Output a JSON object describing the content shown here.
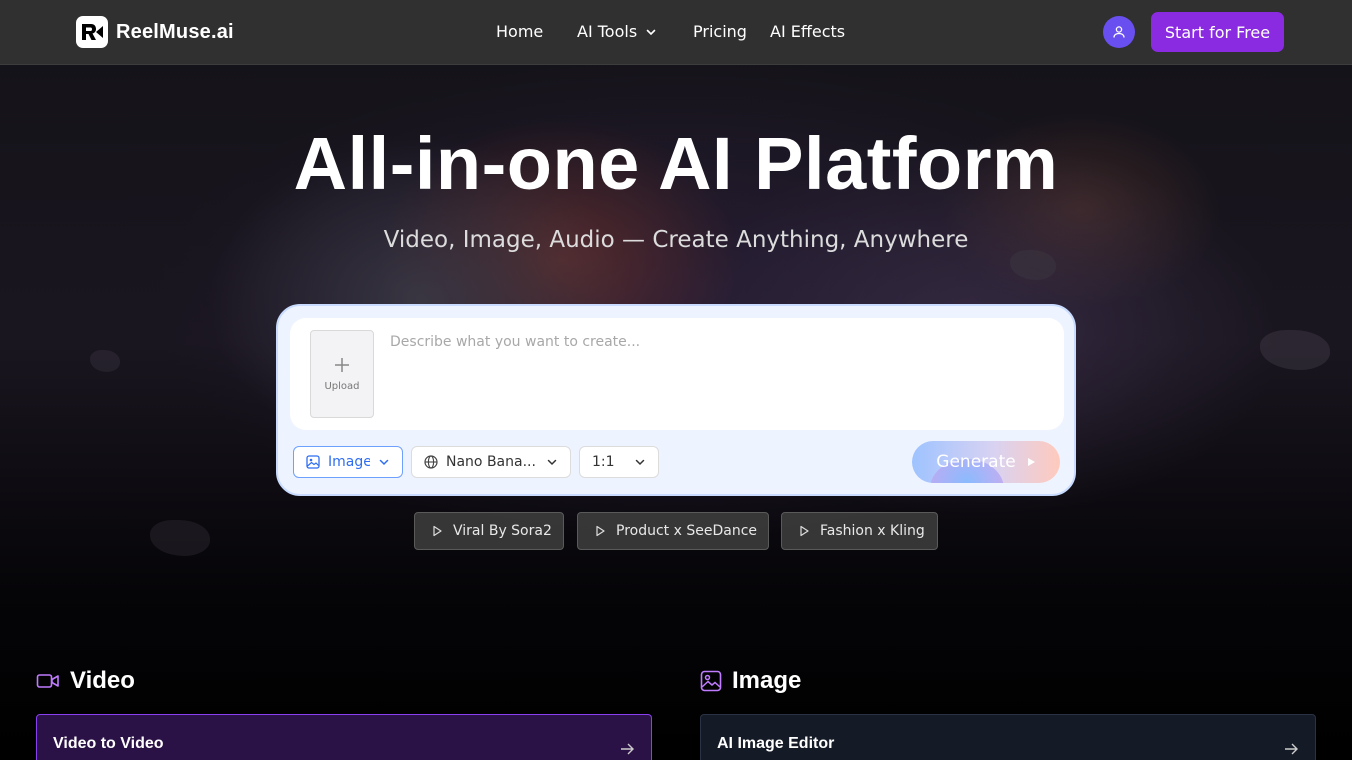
{
  "nav": {
    "brand": "ReelMuse.ai",
    "links": [
      "Home",
      "AI Tools",
      "Pricing",
      "AI Effects"
    ],
    "cta_label": "Start for Free"
  },
  "hero": {
    "title": "All-in-one AI Platform",
    "subtitle": "Video, Image, Audio — Create Anything, Anywhere"
  },
  "prompt": {
    "upload_label": "Upload",
    "placeholder": "Describe what you want to create...",
    "value": "",
    "mode": "Image",
    "model": "Nano Bana...",
    "ratio": "1:1",
    "generate_label": "Generate"
  },
  "templates": [
    "Viral By Sora2",
    "Product x SeeDance",
    "Fashion x Kling"
  ],
  "sections": {
    "video": {
      "title": "Video",
      "first_card": "Video to Video"
    },
    "image": {
      "title": "Image",
      "first_card": "AI Image Editor"
    }
  },
  "colors": {
    "accent": "#8a2be2",
    "avatar": "#6a4ff0",
    "nav_bg": "#303030",
    "card_bg": "#eef4ff",
    "video_card_border": "#8a3ff0"
  },
  "icons": [
    "logo-icon",
    "chevron-down-icon",
    "user-icon",
    "plus-icon",
    "image-icon",
    "globe-icon",
    "play-icon",
    "video-camera-icon",
    "arrow-right-icon"
  ]
}
